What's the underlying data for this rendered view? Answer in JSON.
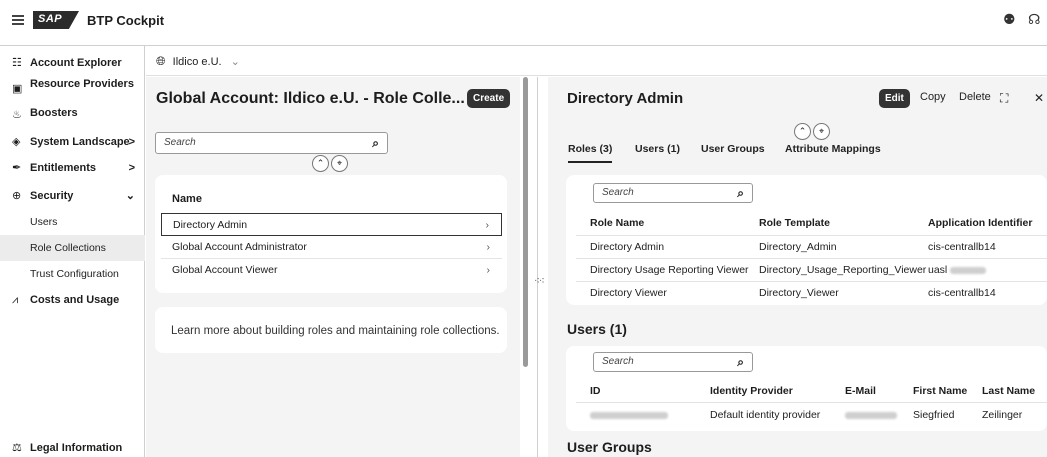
{
  "shell": {
    "logo": "SAP",
    "title": "BTP Cockpit",
    "icon_right_1": "help-icon",
    "icon_right_2": "feedback-icon"
  },
  "sidebar": {
    "items": [
      {
        "label": "Account Explorer",
        "icon": "hierarchy-icon"
      },
      {
        "label": "Resource Providers",
        "icon": "resource-icon"
      },
      {
        "label": "Boosters",
        "icon": "booster-icon"
      },
      {
        "label": "System Landscape",
        "icon": "landscape-icon",
        "chevron": ">"
      },
      {
        "label": "Entitlements",
        "icon": "entitlement-icon",
        "chevron": ">"
      },
      {
        "label": "Security",
        "icon": "security-icon",
        "chevron": "⌄"
      }
    ],
    "security_sub": [
      "Users",
      "Role Collections",
      "Trust Configuration"
    ],
    "costs": "Costs and Usage",
    "legal": "Legal Information"
  },
  "breadcrumb": {
    "account": "Ildico e.U."
  },
  "list": {
    "title": "Global Account: Ildico e.U. - Role Colle...",
    "create_label": "Create",
    "search_placeholder": "Search",
    "column_name": "Name",
    "rows": [
      "Directory Admin",
      "Global Account Administrator",
      "Global Account Viewer"
    ],
    "learn_more": "Learn more about building roles and maintaining role collections."
  },
  "detail": {
    "title": "Directory Admin",
    "edit_label": "Edit",
    "copy_label": "Copy",
    "delete_label": "Delete",
    "tabs": [
      "Roles (3)",
      "Users (1)",
      "User Groups",
      "Attribute Mappings"
    ],
    "roles": {
      "search_placeholder": "Search",
      "columns": [
        "Role Name",
        "Role Template",
        "Application Identifier"
      ],
      "rows": [
        [
          "Directory Admin",
          "Directory_Admin",
          "cis-centrallb14"
        ],
        [
          "Directory Usage Reporting Viewer",
          "Directory_Usage_Reporting_Viewer",
          "uasl"
        ],
        [
          "Directory Viewer",
          "Directory_Viewer",
          "cis-centrallb14"
        ]
      ]
    },
    "users_title": "Users (1)",
    "users": {
      "search_placeholder": "Search",
      "columns": [
        "ID",
        "Identity Provider",
        "E-Mail",
        "First Name",
        "Last Name"
      ],
      "rows": [
        [
          "",
          "Default identity provider",
          "",
          "Siegfried",
          "Zeilinger"
        ]
      ]
    },
    "groups_title": "User Groups"
  }
}
